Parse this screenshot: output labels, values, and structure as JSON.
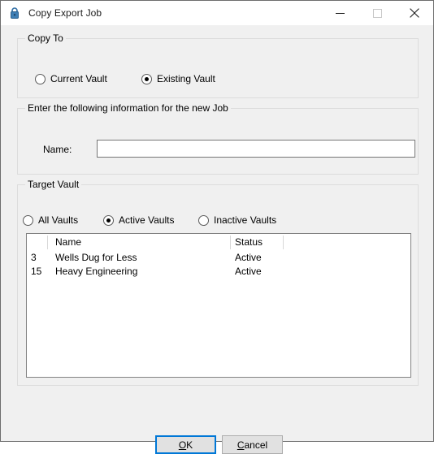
{
  "window": {
    "title": "Copy Export Job",
    "icon": "padlock-icon",
    "controls": {
      "minimize": "minimize-icon",
      "maximize": "maximize-icon",
      "close": "close-icon",
      "maximize_enabled": false
    },
    "background_color": "#f0f0f0",
    "accent_color": "#0078d7"
  },
  "copy_to": {
    "legend": "Copy To",
    "options": [
      {
        "label": "Current Vault",
        "checked": false
      },
      {
        "label": "Existing Vault",
        "checked": true
      }
    ]
  },
  "job_info": {
    "legend": "Enter the following information for the new Job",
    "name_label": "Name:",
    "name_value": "",
    "name_placeholder": ""
  },
  "target_vault": {
    "legend": "Target Vault",
    "options": [
      {
        "label": "All Vaults",
        "checked": false
      },
      {
        "label": "Active Vaults",
        "checked": true
      },
      {
        "label": "Inactive Vaults",
        "checked": false
      }
    ],
    "list": {
      "columns": [
        "",
        "Name",
        "Status",
        ""
      ],
      "rows": [
        {
          "id": "3",
          "name": "Wells Dug for Less",
          "status": "Active"
        },
        {
          "id": "15",
          "name": "Heavy Engineering",
          "status": "Active"
        }
      ]
    }
  },
  "footer": {
    "ok": {
      "prefix": "",
      "accel": "O",
      "suffix": "K"
    },
    "cancel": {
      "prefix": "",
      "accel": "C",
      "suffix": "ancel"
    }
  }
}
